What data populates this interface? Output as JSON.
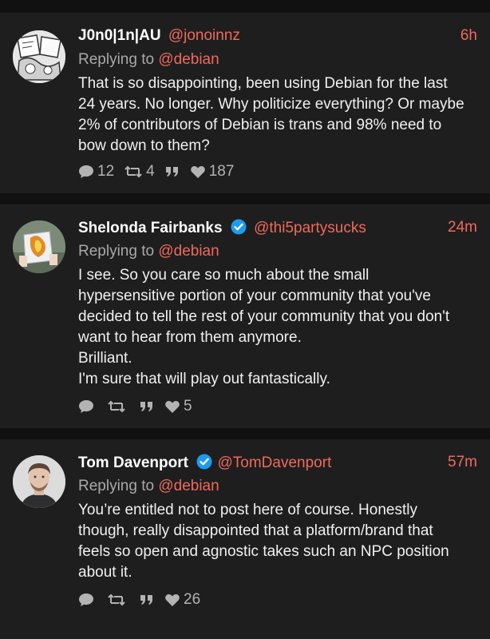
{
  "colors": {
    "background": "#111111",
    "card": "#1e1e1f",
    "accent": "#ef6a5a",
    "verified": "#1d9bf0"
  },
  "tweets": [
    {
      "name": "J0n0|1n|AU",
      "handle": "@jonoinnz",
      "verified": false,
      "time": "6h",
      "reply_prefix": "Replying to",
      "reply_to": "@debian",
      "lines": [
        "That is so disappointing,  been using Debian for the last",
        "24 years. No longer. Why politicize everything? Or maybe",
        "2% of contributors of Debian is trans and 98% need to",
        "bow down to them?"
      ],
      "replies": "12",
      "retweets": "4",
      "likes": "187"
    },
    {
      "name": "Shelonda Fairbanks",
      "handle": "@thi5partysucks",
      "verified": true,
      "time": "24m",
      "reply_prefix": "Replying to",
      "reply_to": "@debian",
      "lines": [
        "I see. So you care so much about the small",
        "hypersensitive portion of your community that you've",
        "decided to tell the rest of your community that you don't",
        "want to hear from them anymore.",
        "Brilliant.",
        "I'm sure that will play out fantastically."
      ],
      "replies": "",
      "retweets": "",
      "likes": "5"
    },
    {
      "name": "Tom Davenport",
      "handle": "@TomDavenport",
      "verified": true,
      "time": "57m",
      "reply_prefix": "Replying to",
      "reply_to": "@debian",
      "lines": [
        "You’re entitled not to post here of course. Honestly",
        "though, really disappointed that a platform/brand that",
        "feels so open and agnostic takes such an NPC position",
        "about it."
      ],
      "replies": "",
      "retweets": "",
      "likes": "26"
    }
  ]
}
